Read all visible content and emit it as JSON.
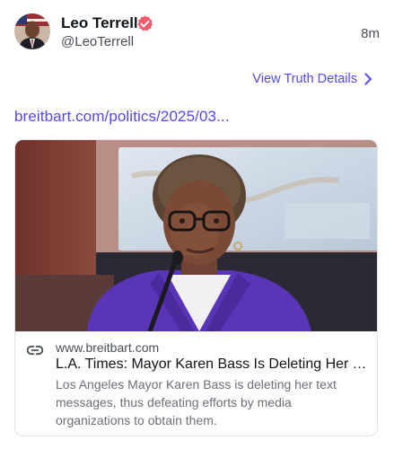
{
  "author": {
    "display_name": "Leo Terrell",
    "handle": "@LeoTerrell",
    "verified": true,
    "avatar": "profile-photo"
  },
  "post": {
    "time_ago": "8m",
    "view_details_label": "View Truth Details",
    "link_text": "breitbart.com/politics/2025/03..."
  },
  "link_card": {
    "image": "mayor-karen-bass-photo",
    "domain": "www.breitbart.com",
    "title": "L.A. Times: Mayor Karen Bass Is Deleting Her Text Messages",
    "description": "Los Angeles Mayor Karen Bass is deleting her text messages, thus defeating efforts by media organizations to obtain them.",
    "icon": "link-icon"
  },
  "colors": {
    "accent": "#5448ee",
    "verified_badge": "#f45a6e",
    "text_primary": "#0f1419",
    "text_secondary": "#4a4e57",
    "card_border": "#e2e3e8"
  }
}
